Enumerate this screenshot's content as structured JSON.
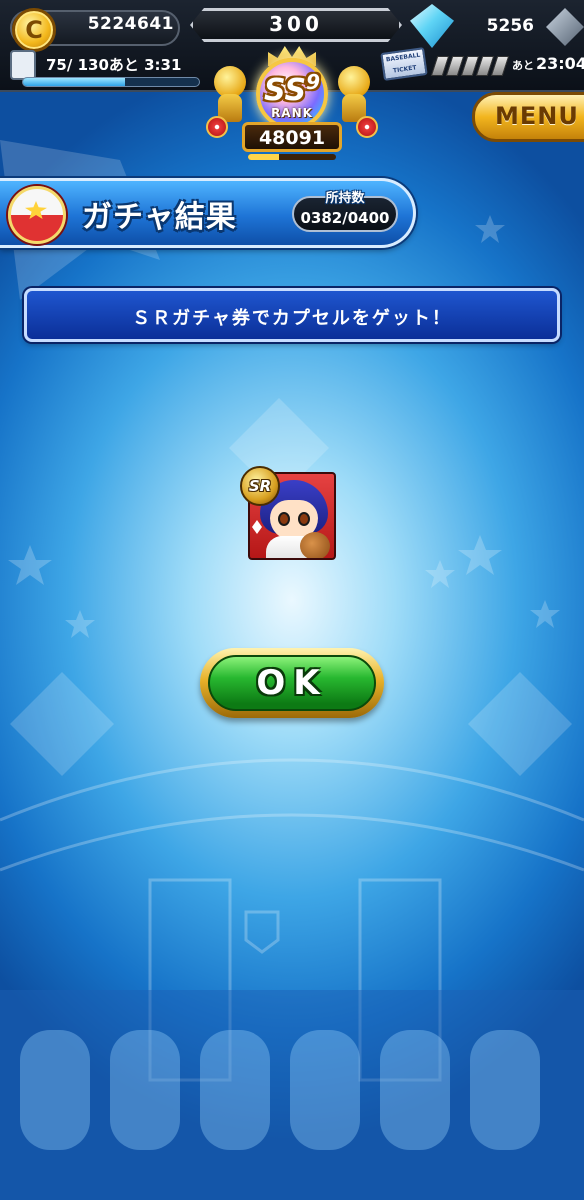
{
  "hud": {
    "coin_value": "5224641",
    "stamina_value": "300",
    "gem_value": "5256",
    "exp_text": "75/ 130あと 3:31",
    "exp_fill": 0.58,
    "ticket_prefix": "あと",
    "ticket_time": "23:04",
    "ticket_icon_text": "BASEBALL TICKET",
    "rank_grade": "SS",
    "rank_sub": "9",
    "rank_label": "RANK",
    "rank_score": "48091",
    "rank_progress": 0.35,
    "coin_symbol": "C"
  },
  "menu": {
    "label": "MENU"
  },
  "title_banner": {
    "title": "ガチャ結果",
    "owned_label": "所持数",
    "owned_count": "0382/0400"
  },
  "message": "ＳＲガチャ券でカプセルをゲット！",
  "reward": {
    "rarity_badge": "SR"
  },
  "ok_button": {
    "label": "OK"
  },
  "colors": {
    "background": "#3ea6e6",
    "banner_blue": "#1e74d6",
    "ok_green": "#28b830",
    "gold": "#e8b22a",
    "card_red": "#e64242"
  },
  "icons": {
    "coin": "coin-icon",
    "gem": "gem-icon",
    "capsule": "capsule-icon",
    "ticket": "ticket-icon"
  }
}
